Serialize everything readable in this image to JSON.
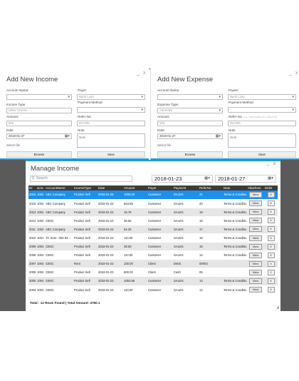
{
  "income": {
    "title": "Add New Income",
    "account_name_label": "Account Name:",
    "payer_label": "Payer:",
    "payer_value": "Bank Loan",
    "income_type_label": "Income Type",
    "income_type_value": "Other Income",
    "payment_method_label": "Payment Method",
    "amount_label": "Amount:",
    "amount_value": "500",
    "refer_no_label": "Refer No:",
    "refer_no_value": "INA095",
    "date_label": "Date",
    "date_value": "2018-01-27",
    "note_label": "Note",
    "note_value": "Note",
    "select_file": "Select file",
    "browse_label": "Browse",
    "save_label": "Save"
  },
  "expense": {
    "title": "Add New Expense",
    "account_name_label": "Account Name:",
    "payee_label": "Payee:",
    "payee_value": "Bank Loan",
    "expense_type_label": "Expense Type:",
    "expense_type_value": "Advertise",
    "payment_method_label": "Payment Method",
    "amount_label": "Amount:",
    "amount_value": "500",
    "refer_no_label": "Refer No:",
    "refer_no_placeholder": "e.g. Transaction ID, check No.",
    "refer_no_value": "INA095",
    "date_label": "Date:",
    "date_value": "2018-01-27",
    "note_label": "Note",
    "note_value": "Note",
    "select_file": "Select file",
    "browse_label": "Browse",
    "save_label": "Save"
  },
  "window_controls": {
    "minimize": "_",
    "close": "X"
  },
  "manage": {
    "title": "Manage Income",
    "search_placeholder": "Search",
    "date_from": "2018-01-23",
    "date_to": "2018-01-27",
    "columns": [
      "ID",
      "acnc",
      "AccountName",
      "IncomeType",
      "Date",
      "Amount",
      "Payer",
      "Payment",
      "ReferNo",
      "Note",
      "Attachme",
      "Delet"
    ],
    "view_label": "View",
    "delete_label": "X",
    "rows": [
      [
        "2016",
        "1002",
        "ABC Company",
        "Product Sell",
        "2018-01-26",
        "1000.20",
        "Customer",
        "SALES",
        "21",
        "Terms & Conditio..."
      ],
      [
        "2015",
        "1002",
        "ABC Company",
        "Product Sell",
        "2018-01-23",
        "843.85",
        "Customer",
        "SALES",
        "20",
        "Terms & Conditio..."
      ],
      [
        "2013",
        "1002",
        "ABC Company",
        "Product Sell",
        "2018-01-23",
        "15.76",
        "Customer",
        "SALES",
        "18",
        "Terms & Conditio..."
      ],
      [
        "2012",
        "1004",
        "CBSC",
        "Product Sell",
        "2018-01-23",
        "38.50",
        "Customer",
        "SALES",
        "16",
        "Terms & Conditio..."
      ],
      [
        "2011",
        "1002",
        "ABC Company",
        "Product Sell",
        "2018-01-23",
        "54.25",
        "Customer",
        "SALES",
        "17",
        "Terms & Conditio..."
      ],
      [
        "2010",
        "1001",
        "TC trust - 004 64...",
        "Product Sell",
        "2018-01-23",
        "110.00",
        "Customer",
        "SALES",
        "15",
        "Terms & Conditio..."
      ],
      [
        "2009",
        "1004",
        "CBSC",
        "Product Sell",
        "2018-01-23",
        "38.50",
        "Customer",
        "SALES",
        "15",
        "Terms & Conditio..."
      ],
      [
        "2008",
        "1004",
        "CBSC",
        "Product Sell",
        "2018-01-23",
        "110.00",
        "Customer",
        "SALES",
        "14",
        "Terms & Conditio..."
      ],
      [
        "2007",
        "1004",
        "CBSC",
        "Rent",
        "2018-01-23",
        "100.00",
        "Client",
        "Debit",
        "00003",
        ""
      ],
      [
        "2006",
        "1004",
        "CBSC",
        "Product Sell",
        "2018-01-23",
        "600.00",
        "Client",
        "Cash",
        "05",
        ""
      ],
      [
        "2005",
        "1004",
        "CBSC",
        "Product Sell",
        "2018-01-23",
        "1053.56",
        "Customer",
        "SALES",
        "13",
        "Terms & Conditio..."
      ],
      [
        "2004",
        "1004",
        "CBSC",
        "Product Sell",
        "2018-01-23",
        "110.00",
        "Customer",
        "SALES",
        "12",
        "Terms & Conditio..."
      ]
    ],
    "footer": "Total : 12 Rows Found    |   Total Amount: 4760.1"
  },
  "colors": {
    "accent": "#1f9bd7",
    "selected_row": "#1e90ea",
    "header": "#3b3b3b"
  }
}
